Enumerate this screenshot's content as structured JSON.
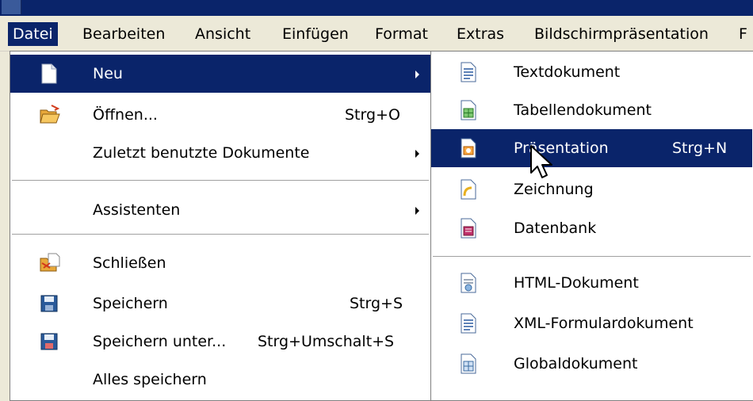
{
  "menubar": {
    "items": [
      {
        "label": "Datei",
        "active": true
      },
      {
        "label": "Bearbeiten"
      },
      {
        "label": "Ansicht"
      },
      {
        "label": "Einfügen"
      },
      {
        "label": "Format"
      },
      {
        "label": "Extras"
      },
      {
        "label": "Bildschirmpräsentation"
      },
      {
        "label": "F"
      }
    ]
  },
  "datei_menu": {
    "neu": {
      "label": "Neu",
      "icon": "new-document-icon"
    },
    "oeffnen": {
      "label": "Öffnen...",
      "shortcut": "Strg+O",
      "icon": "open-folder-icon"
    },
    "zuletzt": {
      "label": "Zuletzt benutzte Dokumente"
    },
    "assistenten": {
      "label": "Assistenten"
    },
    "schliessen": {
      "label": "Schließen",
      "icon": "close-document-icon"
    },
    "speichern": {
      "label": "Speichern",
      "shortcut": "Strg+S",
      "icon": "save-disk-icon"
    },
    "speichern_unter": {
      "label": "Speichern unter...",
      "shortcut": "Strg+Umschalt+S",
      "icon": "save-as-disk-icon"
    },
    "alles_speichern": {
      "label": "Alles speichern"
    }
  },
  "neu_submenu": {
    "textdokument": {
      "label": "Textdokument",
      "icon": "text-document-icon"
    },
    "tabellendokument": {
      "label": "Tabellendokument",
      "icon": "spreadsheet-icon"
    },
    "praesentation": {
      "label": "Präsentation",
      "shortcut": "Strg+N",
      "icon": "presentation-icon",
      "highlighted": true
    },
    "zeichnung": {
      "label": "Zeichnung",
      "icon": "drawing-icon"
    },
    "datenbank": {
      "label": "Datenbank",
      "icon": "database-icon"
    },
    "html_dokument": {
      "label": "HTML-Dokument",
      "icon": "html-document-icon"
    },
    "xml_formular": {
      "label": "XML-Formulardokument",
      "icon": "xml-form-icon"
    },
    "globaldokument": {
      "label": "Globaldokument",
      "icon": "master-document-icon"
    }
  },
  "colors": {
    "highlight": "#0a246a",
    "menu_bg": "#ffffff",
    "bar_bg": "#ece9d8"
  }
}
